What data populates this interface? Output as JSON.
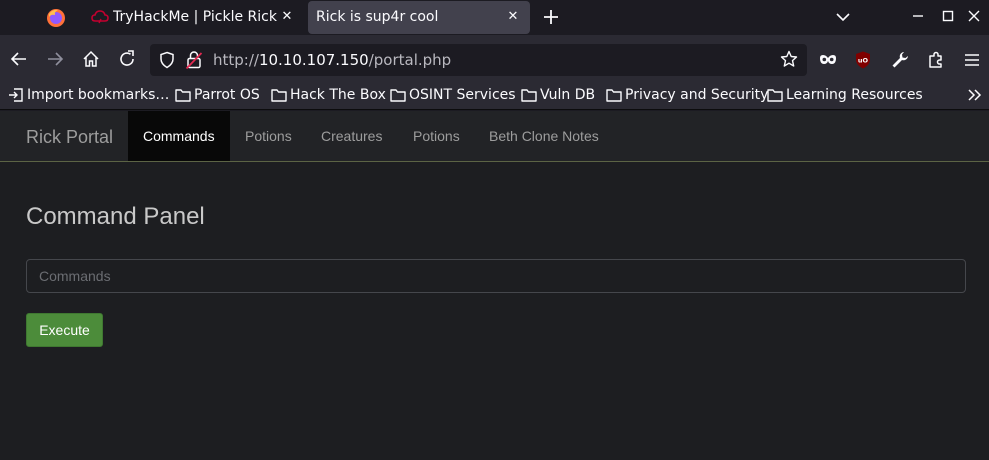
{
  "browser": {
    "tabs": [
      {
        "title": "TryHackMe | Pickle Rick",
        "close_glyph": "✕",
        "icon": "thm-cloud-icon",
        "active": false
      },
      {
        "title": "Rick is sup4r cool",
        "close_glyph": "✕",
        "active": true
      }
    ],
    "url": {
      "scheme": "http://",
      "host": "10.10.107.150",
      "path": "/portal.php"
    },
    "bookmarks": [
      {
        "label": "Import bookmarks…",
        "icon": "import-icon"
      },
      {
        "label": "Parrot OS",
        "icon": "folder-icon"
      },
      {
        "label": "Hack The Box",
        "icon": "folder-icon"
      },
      {
        "label": "OSINT Services",
        "icon": "folder-icon"
      },
      {
        "label": "Vuln DB",
        "icon": "folder-icon"
      },
      {
        "label": "Privacy and Security",
        "icon": "folder-icon"
      },
      {
        "label": "Learning Resources",
        "icon": "folder-icon"
      }
    ]
  },
  "site": {
    "brand": "Rick Portal",
    "nav": [
      {
        "label": "Commands",
        "active": true
      },
      {
        "label": "Potions",
        "active": false
      },
      {
        "label": "Creatures",
        "active": false
      },
      {
        "label": "Potions",
        "active": false
      },
      {
        "label": "Beth Clone Notes",
        "active": false
      }
    ],
    "panel_title": "Command Panel",
    "command_input": {
      "placeholder": "Commands",
      "value": ""
    },
    "execute_label": "Execute"
  },
  "colors": {
    "accent_green": "#4c8c3a",
    "active_tab_bg": "#42414d",
    "page_bg": "#1d1e21"
  }
}
